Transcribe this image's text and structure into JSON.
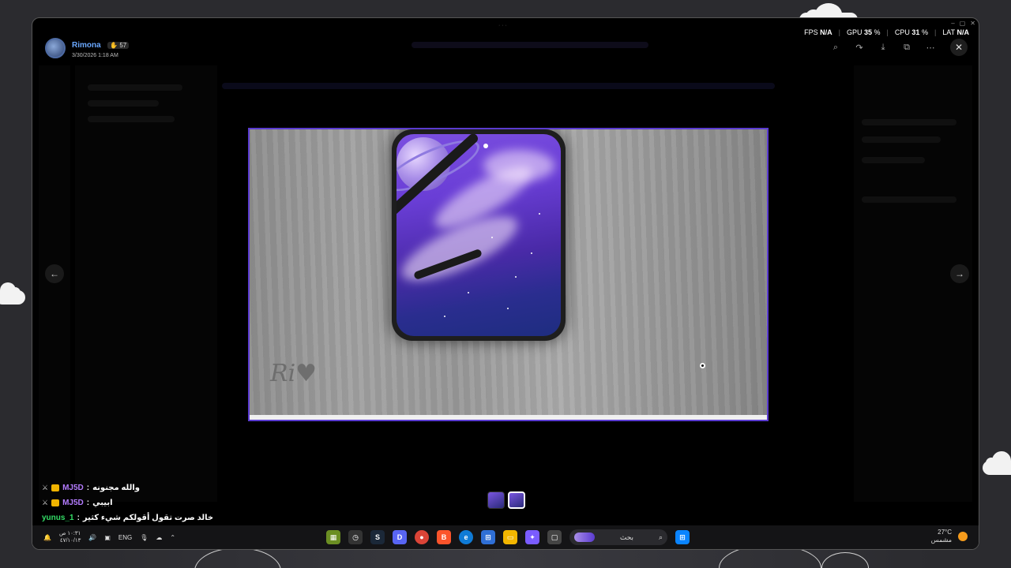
{
  "author": {
    "name": "Rimona",
    "badge_count": "57",
    "timestamp": "3/30/2026 1:18 AM"
  },
  "stats": {
    "fps_label": "FPS",
    "fps_value": "N/A",
    "gpu_label": "GPU",
    "gpu_value": "35",
    "cpu_label": "CPU",
    "cpu_value": "31",
    "lat_label": "LAT",
    "lat_value": "N/A",
    "unit": "%"
  },
  "toolbar": {
    "zoom_icon": "zoom-icon",
    "forward_icon": "forward-icon",
    "download_icon": "download-icon",
    "open_icon": "open-external-icon",
    "more_icon": "more-icon",
    "close_icon": "close-icon"
  },
  "image": {
    "signature": "Ri♥"
  },
  "chat": [
    {
      "user": "MJ5D",
      "message": "والله مجنونه",
      "color": "#b47cff"
    },
    {
      "user": "MJ5D",
      "message": "ابيبي",
      "color": "#b47cff"
    },
    {
      "user": "yunus_1",
      "message": "خالد صرت تقول أقولكم شيء كثير",
      "color": "#33dd66"
    }
  ],
  "taskbar": {
    "time": "١٠:٣١ ص",
    "date": "٤٧/١٠/١٣",
    "language": "ENG",
    "search_placeholder": "بحث",
    "temperature": "27°C",
    "weather": "مشمس"
  }
}
